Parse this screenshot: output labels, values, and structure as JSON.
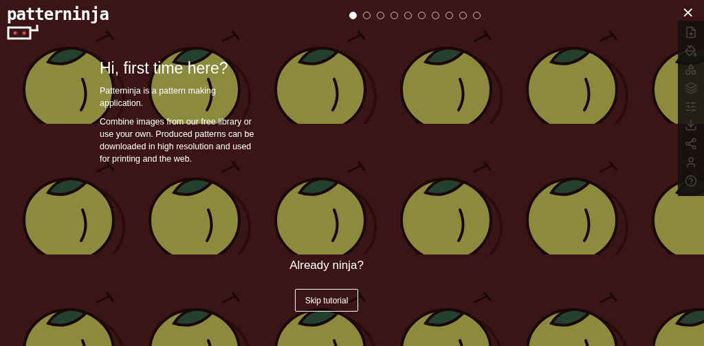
{
  "logo": {
    "text": "patterninja"
  },
  "steps": [
    {
      "selected": true
    },
    {
      "selected": false
    },
    {
      "selected": false
    },
    {
      "selected": false
    },
    {
      "selected": false
    },
    {
      "selected": false
    },
    {
      "selected": false
    },
    {
      "selected": false
    },
    {
      "selected": false
    },
    {
      "selected": false
    }
  ],
  "close": {
    "label": "×"
  },
  "intro": {
    "title": "Hi, first time here?",
    "paragraphs": [
      "Patterninja is a pattern making application.",
      "Combine images from our free library or use your own. Produced patterns can be downloaded in high resolution and used for printing and the web."
    ]
  },
  "skip": {
    "title": "Already ninja?",
    "button": "Skip tutorial"
  }
}
